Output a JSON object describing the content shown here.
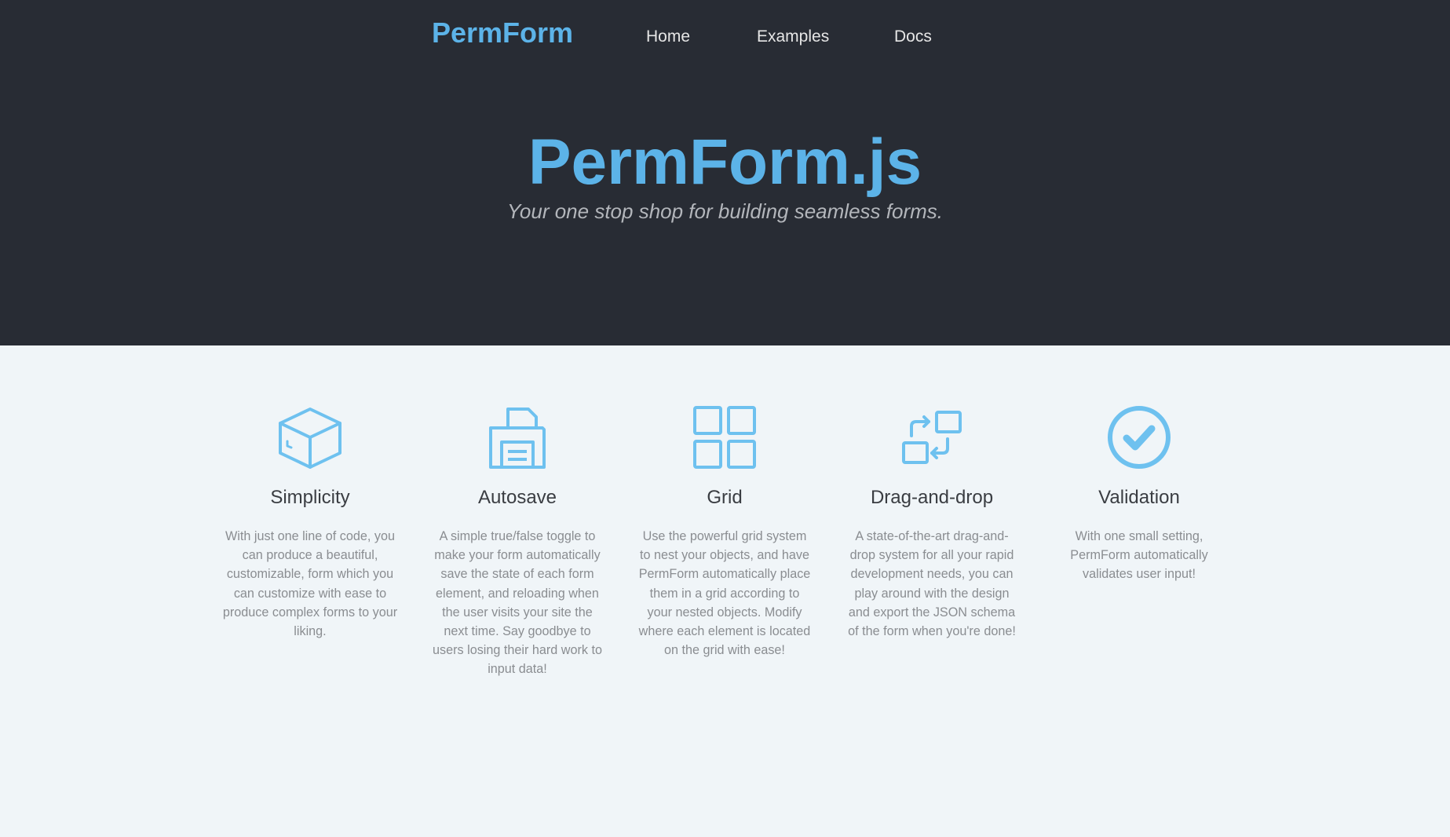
{
  "header": {
    "brand": "PermForm",
    "nav": [
      "Home",
      "Examples",
      "Docs"
    ]
  },
  "hero": {
    "title": "PermForm.js",
    "subtitle": "Your one stop shop for building seamless forms."
  },
  "features": [
    {
      "icon": "cube-icon",
      "title": "Simplicity",
      "description": "With just one line of code, you can produce a beautiful, customizable, form which you can customize with ease to produce complex forms to your liking."
    },
    {
      "icon": "floppy-disk-icon",
      "title": "Autosave",
      "description": "A simple true/false toggle to make your form automatically save the state of each form element, and reloading when the user visits your site the next time. Say goodbye to users losing their hard work to input data!"
    },
    {
      "icon": "grid-icon",
      "title": "Grid",
      "description": "Use the powerful grid system to nest your objects, and have PermForm automatically place them in a grid according to your nested objects. Modify where each element is located on the grid with ease!"
    },
    {
      "icon": "drag-and-drop-icon",
      "title": "Drag-and-drop",
      "description": "A state-of-the-art drag-and-drop system for all your rapid development needs, you can play around with the design and export the JSON schema of the form when you're done!"
    },
    {
      "icon": "check-circle-icon",
      "title": "Validation",
      "description": "With one small setting, PermForm automatically validates user input!"
    }
  ],
  "colors": {
    "accent": "#5cb3e8",
    "hero_background": "#282c34",
    "page_background": "#f0f5f8",
    "icon": "#6ec1ef"
  }
}
